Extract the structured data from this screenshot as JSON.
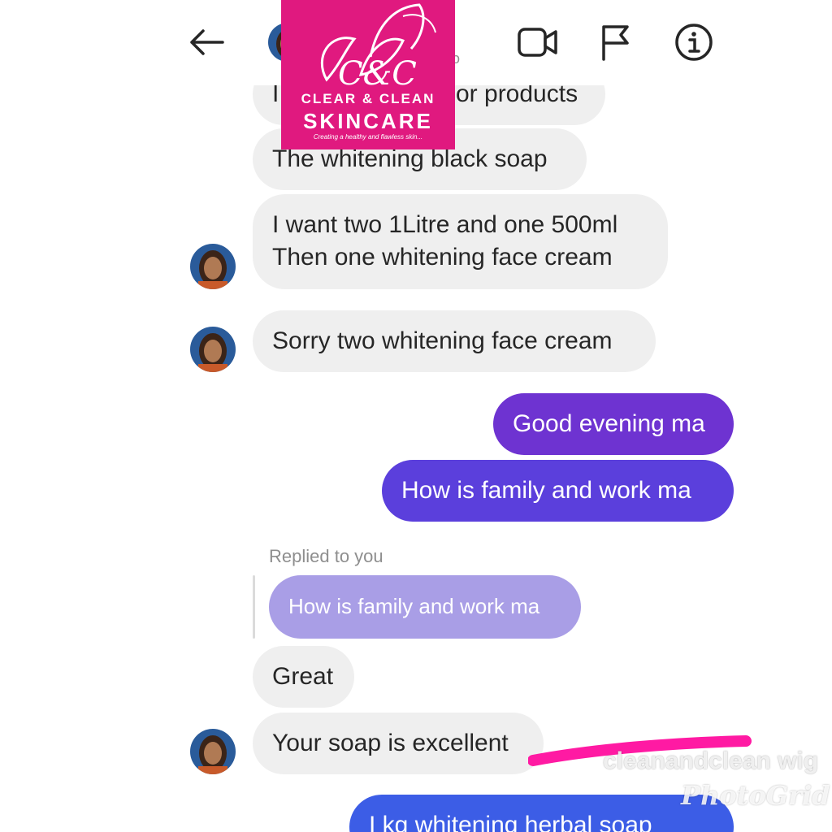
{
  "header": {
    "back_icon": "arrow-left-icon",
    "video_icon": "video-camera-icon",
    "flag_icon": "flag-icon",
    "info_icon": "info-icon",
    "subtitle_fragment": "o"
  },
  "logo": {
    "brand_line1": "CLEAR & CLEAN",
    "brand_line2": "SKINCARE",
    "tagline": "Creating a healthy and flawless skin...",
    "monogram": "C&C",
    "color": "#e0197f"
  },
  "messages": {
    "m1": "I",
    "m1b": "or products",
    "m2": "The whitening black soap",
    "m3_line1": "I want two 1Litre and one 500ml",
    "m3_line2": "Then one whitening face cream",
    "m4": "Sorry two whitening face cream",
    "m5": "Good evening ma",
    "m6": "How is family and work ma",
    "reply_label": "Replied to you",
    "quoted": "How is family and work ma",
    "m7": "Great",
    "m8": "Your soap is excellent",
    "m9": "I kg whitening herbal soap"
  },
  "overlays": {
    "watermark_text": "cleanandclean wig",
    "photogrid": "PhotoGrid",
    "stroke_color": "#ff1aa3"
  },
  "colors": {
    "incoming_bubble": "#efefef",
    "outgoing_purple": "#6e33d1",
    "outgoing_indigo": "#5b3fdc",
    "outgoing_blue": "#3c5de6",
    "quoted_bubble": "#a99ee6"
  }
}
